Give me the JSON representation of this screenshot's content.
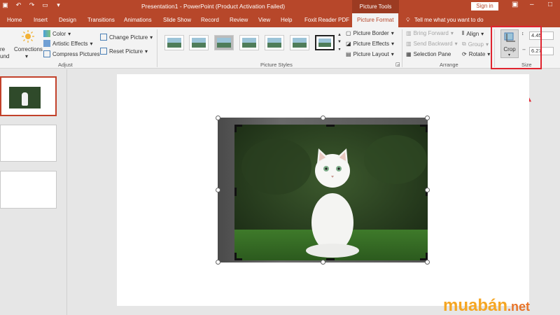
{
  "window": {
    "title": "Presentation1  -  PowerPoint (Product Activation Failed)",
    "context_tab_group": "Picture Tools",
    "sign_in": "Sign in"
  },
  "tabs": [
    "Home",
    "Insert",
    "Design",
    "Transitions",
    "Animations",
    "Slide Show",
    "Record",
    "Review",
    "View",
    "Help",
    "Foxit Reader PDF",
    "Picture Format"
  ],
  "active_tab": "Picture Format",
  "tell_me": "Tell me what you want to do",
  "ribbon": {
    "adjust": {
      "partial_left_top": "re",
      "partial_left_bottom": "und",
      "corrections": "Corrections",
      "color": "Color",
      "artistic_effects": "Artistic Effects",
      "compress_pictures": "Compress Pictures",
      "change_picture": "Change Picture",
      "reset_picture": "Reset Picture",
      "label": "Adjust"
    },
    "picture_styles": {
      "label": "Picture Styles",
      "picture_border": "Picture Border",
      "picture_effects": "Picture Effects",
      "picture_layout": "Picture Layout"
    },
    "arrange": {
      "label": "Arrange",
      "bring_forward": "Bring Forward",
      "send_backward": "Send Backward",
      "selection_pane": "Selection Pane",
      "align": "Align",
      "group": "Group",
      "rotate": "Rotate"
    },
    "size": {
      "label": "Size",
      "crop": "Crop",
      "height": "4.45",
      "width": "6.27"
    }
  },
  "watermark": {
    "part1": "muabán",
    "part2": ".net"
  },
  "colors": {
    "accent": "#b7472a",
    "highlight": "#e0242f"
  }
}
